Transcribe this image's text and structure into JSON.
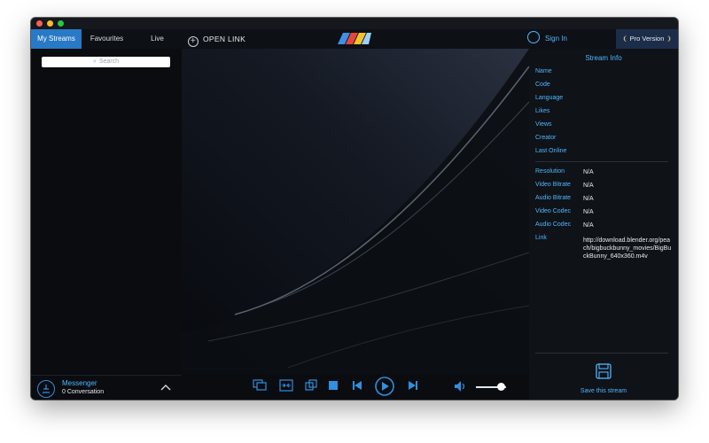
{
  "tabs": [
    {
      "label": "My Streams",
      "active": true
    },
    {
      "label": "Favourites",
      "active": false
    },
    {
      "label": "Live",
      "active": false
    }
  ],
  "toolbar": {
    "open_link": "OPEN LINK",
    "sign_in": "Sign In",
    "pro": "Pro Version"
  },
  "search": {
    "placeholder": "Search"
  },
  "messenger": {
    "title": "Messenger",
    "subtitle": "0 Conversation"
  },
  "stream_info": {
    "title": "Stream Info",
    "fields": [
      {
        "label": "Name",
        "value": ""
      },
      {
        "label": "Code",
        "value": ""
      },
      {
        "label": "Language",
        "value": ""
      },
      {
        "label": "Likes",
        "value": ""
      },
      {
        "label": "Views",
        "value": ""
      },
      {
        "label": "Creator",
        "value": ""
      },
      {
        "label": "Last Online",
        "value": ""
      }
    ],
    "tech": [
      {
        "label": "Resolution",
        "value": "N/A"
      },
      {
        "label": "Video Bitrate",
        "value": "N/A"
      },
      {
        "label": "Audio Bitrate",
        "value": "N/A"
      },
      {
        "label": "Video Codec",
        "value": "N/A"
      },
      {
        "label": "Audio Codec",
        "value": "N/A"
      },
      {
        "label": "Link",
        "value": "http://download.blender.org/peach/bigbuckbunny_movies/BigBuckBunny_640x360.m4v"
      }
    ],
    "save_label": "Save this stream"
  },
  "icons": {
    "controls": [
      "subtitles-icon",
      "aspect-ratio-icon",
      "picture-in-picture-icon",
      "stop-icon",
      "previous-icon",
      "play-icon",
      "next-icon",
      "volume-icon"
    ]
  },
  "colors": {
    "accent": "#4fb7ff",
    "tab_active": "#2879c6",
    "background": "#0c0f14"
  },
  "volume_level": 0.85
}
